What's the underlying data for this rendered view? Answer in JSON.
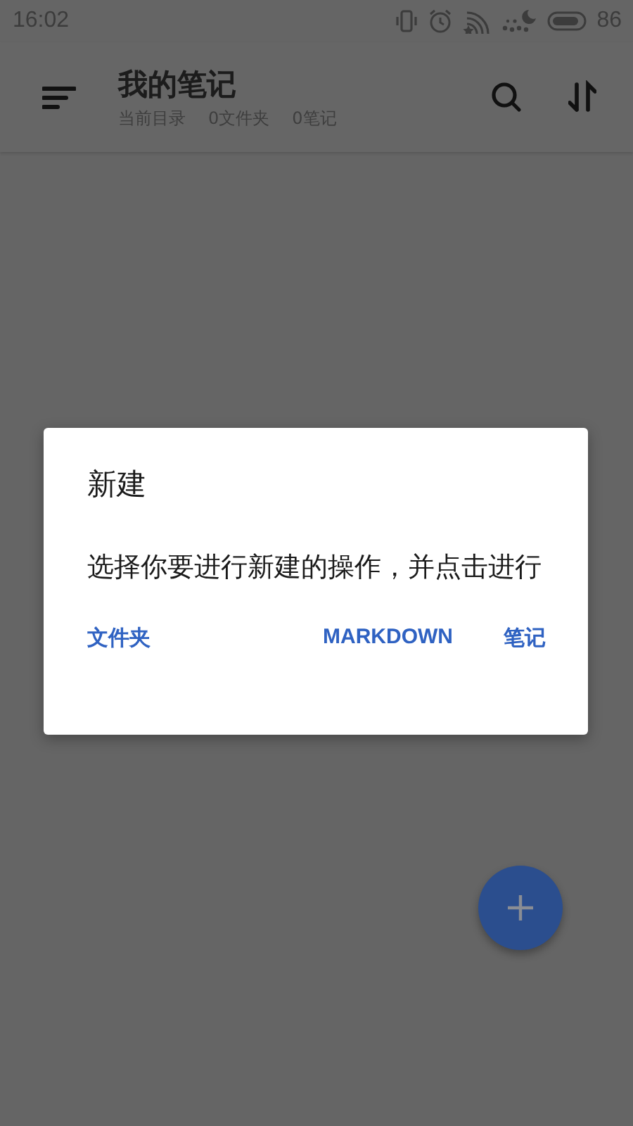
{
  "status_bar": {
    "time": "16:02",
    "battery": "86"
  },
  "toolbar": {
    "title": "我的笔记",
    "subtitle": [
      "当前目录",
      "0文件夹",
      "0笔记"
    ]
  },
  "dialog": {
    "title": "新建",
    "message": "选择你要进行新建的操作，并点击进行",
    "buttons": [
      "文件夹",
      "MARKDOWN",
      "笔记"
    ]
  }
}
